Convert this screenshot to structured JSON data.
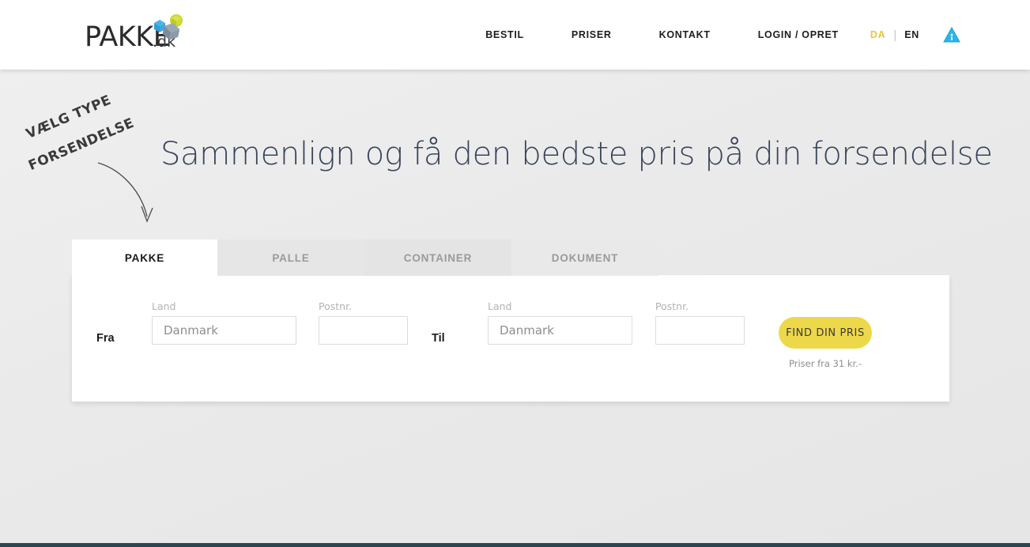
{
  "header": {
    "logo": {
      "name": "PAKKE",
      "suffix": ".dk",
      "icon": "packages-icon"
    },
    "nav_items": [
      {
        "label": "BESTIL",
        "name": "nav-bestil"
      },
      {
        "label": "PRISER",
        "name": "nav-priser"
      },
      {
        "label": "KONTAKT",
        "name": "nav-kontakt"
      },
      {
        "label": "LOGIN / OPRET",
        "name": "nav-login-opret"
      }
    ],
    "languages": {
      "active": "DA",
      "inactive": "EN",
      "separator": "|"
    },
    "info_icon": "info-triangle-icon",
    "accent_color": "#e8c53c",
    "info_icon_color": "#29b6e8"
  },
  "hero": {
    "annotation_line1": "VÆLG TYPE",
    "annotation_line2": "FORSENDELSE",
    "headline": "Sammenlign og få den bedste pris på din forsendelse",
    "headline_color": "#39445a"
  },
  "tabs": [
    {
      "label": "PAKKE",
      "active": true
    },
    {
      "label": "PALLE",
      "active": false
    },
    {
      "label": "CONTAINER",
      "active": false
    },
    {
      "label": "DOKUMENT",
      "active": false
    }
  ],
  "form": {
    "from_label": "Fra",
    "to_label": "Til",
    "fields": {
      "from_country": {
        "label": "Land",
        "value": "Danmark",
        "placeholder": "Danmark"
      },
      "from_zip": {
        "label": "Postnr.",
        "value": "",
        "placeholder": ""
      },
      "to_country": {
        "label": "Land",
        "value": "Danmark",
        "placeholder": "Danmark"
      },
      "to_zip": {
        "label": "Postnr.",
        "value": "",
        "placeholder": ""
      }
    },
    "submit_label": "FIND DIN PRIS",
    "submit_color": "#edd84a",
    "price_note": "Priser fra 31 kr.-"
  }
}
